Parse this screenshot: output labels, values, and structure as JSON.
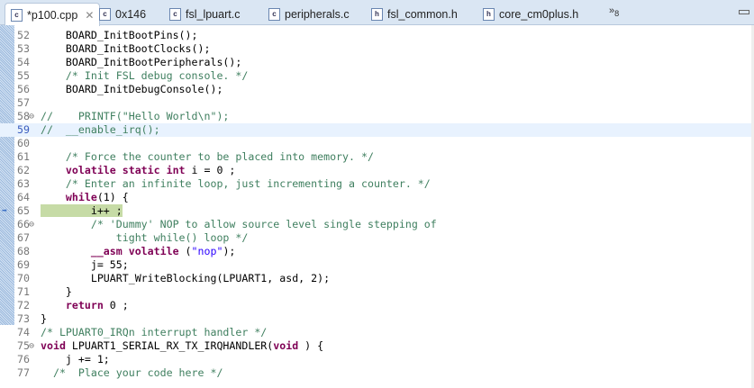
{
  "tabs": [
    {
      "label": "*p100.cpp",
      "icon": "c-file-icon",
      "glyph": "c",
      "active": true
    },
    {
      "label": "0x146",
      "icon": "disassembly-icon",
      "glyph": "c"
    },
    {
      "label": "fsl_lpuart.c",
      "icon": "c-file-icon",
      "glyph": "c"
    },
    {
      "label": "peripherals.c",
      "icon": "c-file-icon",
      "glyph": "c"
    },
    {
      "label": "fsl_common.h",
      "icon": "h-file-icon",
      "glyph": "h"
    },
    {
      "label": "core_cm0plus.h",
      "icon": "h-file-icon",
      "glyph": "h"
    }
  ],
  "overflow": {
    "label": "»",
    "count": "8"
  },
  "close_glyph": "✕",
  "current_line": 59,
  "instruction_line": 65,
  "lines": [
    {
      "n": "52",
      "t": [
        [
          "",
          "    BOARD_InitBootPins();"
        ]
      ]
    },
    {
      "n": "53",
      "t": [
        [
          "",
          "    BOARD_InitBootClocks();"
        ]
      ]
    },
    {
      "n": "54",
      "t": [
        [
          "",
          "    BOARD_InitBootPeripherals();"
        ]
      ]
    },
    {
      "n": "55",
      "t": [
        [
          "cm",
          "    /* Init FSL debug console. */"
        ]
      ]
    },
    {
      "n": "56",
      "t": [
        [
          "",
          "    BOARD_InitDebugConsole();"
        ]
      ]
    },
    {
      "n": "57",
      "t": []
    },
    {
      "n": "58",
      "fold": true,
      "t": [
        [
          "cm",
          "//    PRINTF(\"Hello World\\n\");"
        ]
      ]
    },
    {
      "n": "59",
      "t": [
        [
          "cm",
          "//  __enable_irq();"
        ]
      ]
    },
    {
      "n": "60",
      "t": []
    },
    {
      "n": "61",
      "t": [
        [
          "cm",
          "    /* Force the counter to be placed into memory. */"
        ]
      ]
    },
    {
      "n": "62",
      "t": [
        [
          "",
          "    "
        ],
        [
          "kw",
          "volatile static int"
        ],
        [
          "",
          " i = 0 ;"
        ]
      ]
    },
    {
      "n": "63",
      "t": [
        [
          "cm",
          "    /* Enter an infinite loop, just incrementing a counter. */"
        ]
      ]
    },
    {
      "n": "64",
      "t": [
        [
          "",
          "    "
        ],
        [
          "kw",
          "while"
        ],
        [
          "",
          "(1) {"
        ]
      ]
    },
    {
      "n": "65",
      "t": [
        [
          "hl",
          "        i++ ;"
        ]
      ]
    },
    {
      "n": "66",
      "fold": true,
      "t": [
        [
          "cm",
          "        /* 'Dummy' NOP to allow source level single stepping of"
        ]
      ]
    },
    {
      "n": "67",
      "t": [
        [
          "cm",
          "            tight while() loop */"
        ]
      ]
    },
    {
      "n": "68",
      "t": [
        [
          "",
          "        "
        ],
        [
          "kw",
          "__asm volatile"
        ],
        [
          "",
          " ("
        ],
        [
          "st",
          "\"nop\""
        ],
        [
          "",
          ");"
        ]
      ]
    },
    {
      "n": "69",
      "t": [
        [
          "",
          "        j= 55;"
        ]
      ]
    },
    {
      "n": "70",
      "t": [
        [
          "",
          "        LPUART_WriteBlocking(LPUART1, asd, 2);"
        ]
      ]
    },
    {
      "n": "71",
      "t": [
        [
          "",
          "    }"
        ]
      ]
    },
    {
      "n": "72",
      "t": [
        [
          "",
          "    "
        ],
        [
          "kw",
          "return"
        ],
        [
          "",
          " 0 ;"
        ]
      ]
    },
    {
      "n": "73",
      "t": [
        [
          "",
          "}"
        ]
      ]
    },
    {
      "n": "74",
      "t": [
        [
          "cm",
          "/* LPUART0_IRQn interrupt handler */"
        ]
      ]
    },
    {
      "n": "75",
      "fold": true,
      "t": [
        [
          "kw",
          "void"
        ],
        [
          "",
          " LPUART1_SERIAL_RX_TX_IRQHANDLER("
        ],
        [
          "kw",
          "void"
        ],
        [
          "",
          " ) {"
        ]
      ]
    },
    {
      "n": "76",
      "t": [
        [
          "",
          "    j += 1;"
        ]
      ]
    },
    {
      "n": "77",
      "t": [
        [
          "cm",
          "  /*  Place your code here */"
        ]
      ]
    }
  ]
}
